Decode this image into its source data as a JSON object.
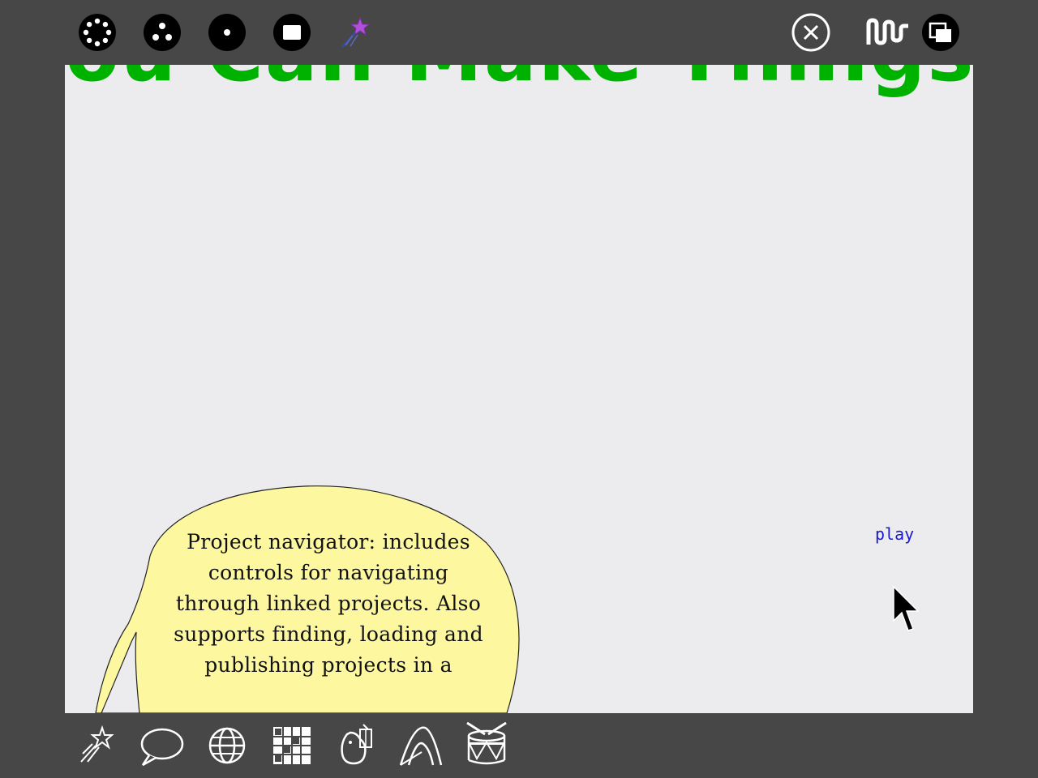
{
  "toolbar_top": {
    "left_buttons": [
      {
        "name": "many-dots-icon"
      },
      {
        "name": "three-dots-icon"
      },
      {
        "name": "one-dot-icon"
      },
      {
        "name": "square-icon"
      },
      {
        "name": "magic-wand-star-icon"
      }
    ],
    "right_buttons": [
      {
        "name": "close-circle-icon"
      },
      {
        "name": "wave-icon"
      },
      {
        "name": "windows-icon"
      }
    ]
  },
  "canvas": {
    "title": "You Can Make Things",
    "title_color": "#00b200",
    "background": "#ecebee",
    "balloon": {
      "text": "Project navigator: includes controls for navigating through linked projects.  Also supports finding, loading and publishing projects in a",
      "fill": "#fdf8a0"
    },
    "play_label": "play",
    "play_color": "#1a1ad0"
  },
  "toolbar_bottom": {
    "buttons": [
      {
        "name": "shooting-star-icon"
      },
      {
        "name": "speech-bubble-icon"
      },
      {
        "name": "globe-icon"
      },
      {
        "name": "grid-icon"
      },
      {
        "name": "bird-cage-icon"
      },
      {
        "name": "curve-icon"
      },
      {
        "name": "drum-icon"
      }
    ]
  }
}
